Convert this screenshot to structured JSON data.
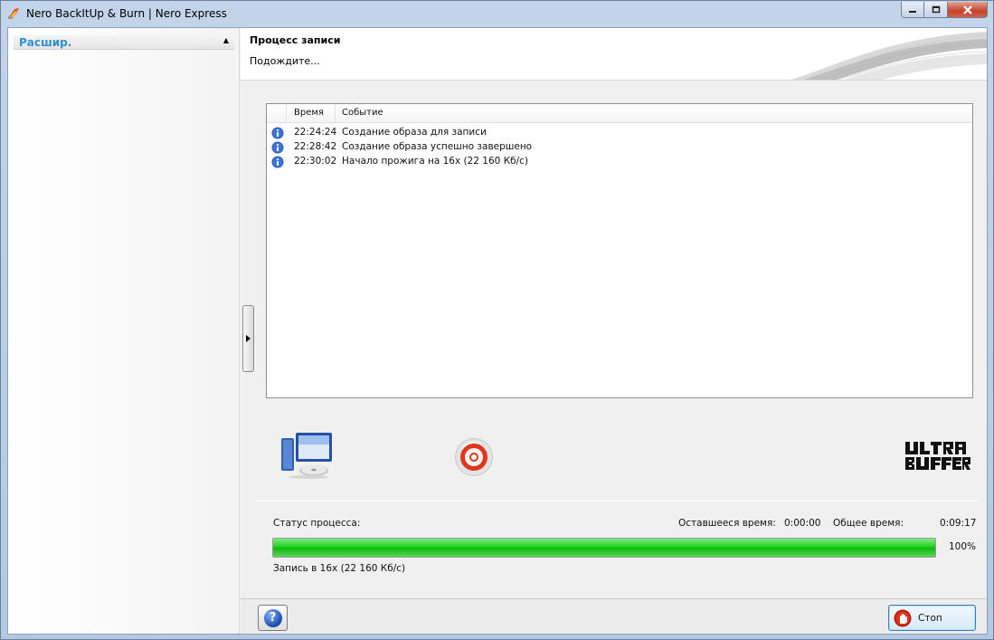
{
  "window": {
    "title": "Nero BackItUp & Burn | Nero Express"
  },
  "sidebar": {
    "header_label": "Расшир.",
    "caret_glyph": "▲"
  },
  "header": {
    "title": "Процесс записи",
    "subtitle": "Подождите..."
  },
  "log": {
    "columns": {
      "time": "Время",
      "event": "Событие"
    },
    "rows": [
      {
        "icon": "info-icon",
        "time": "22:24:24",
        "event": "Создание образа для записи"
      },
      {
        "icon": "info-icon",
        "time": "22:28:42",
        "event": "Создание образа успешно завершено"
      },
      {
        "icon": "info-icon",
        "time": "22:30:02",
        "event": "Начало прожига на 16x (22 160 Кб/с)"
      }
    ]
  },
  "status": {
    "process_label": "Статус процесса:",
    "remaining_label": "Оставшееся время:",
    "remaining_value": "0:00:00",
    "total_label": "Общее время:",
    "total_value": "0:09:17",
    "progress_percent": 100,
    "progress_text": "100%",
    "detail": "Запись в 16x (22 160 Кб/с)"
  },
  "footer": {
    "help_glyph": "?",
    "stop_label": "Стоп"
  },
  "colors": {
    "accent": "#2f8fd8",
    "progress": "#1ed21e"
  }
}
